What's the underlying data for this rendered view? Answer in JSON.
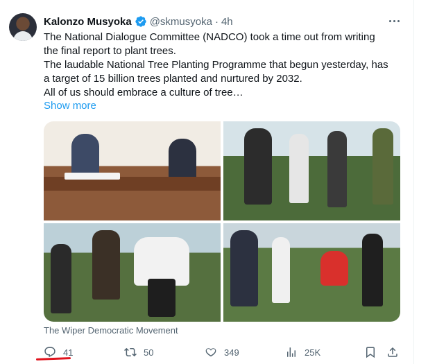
{
  "author": {
    "name": "Kalonzo Musyoka",
    "handle": "@skmusyoka",
    "separator": "·",
    "time": "4h"
  },
  "body": {
    "lines": [
      "The National Dialogue Committee (NADCO) took a time out from writing",
      "the final report to plant trees.",
      "The laudable National Tree Planting Programme that begun yesterday, has",
      "a target of 15 billion trees planted and nurtured by 2032.",
      "All of us should embrace a culture of tree…"
    ],
    "show_more": "Show more"
  },
  "media": {
    "source_label": "The Wiper Democratic Movement"
  },
  "actions": {
    "replies": "41",
    "reposts": "50",
    "likes": "349",
    "views": "25K"
  },
  "colors": {
    "accent": "#1d9bf0",
    "muted": "#536471",
    "annotation": "#e0141e"
  },
  "icons": [
    "verified-badge-icon",
    "more-icon",
    "reply-icon",
    "retweet-icon",
    "like-icon",
    "views-icon",
    "bookmark-icon",
    "share-icon"
  ]
}
